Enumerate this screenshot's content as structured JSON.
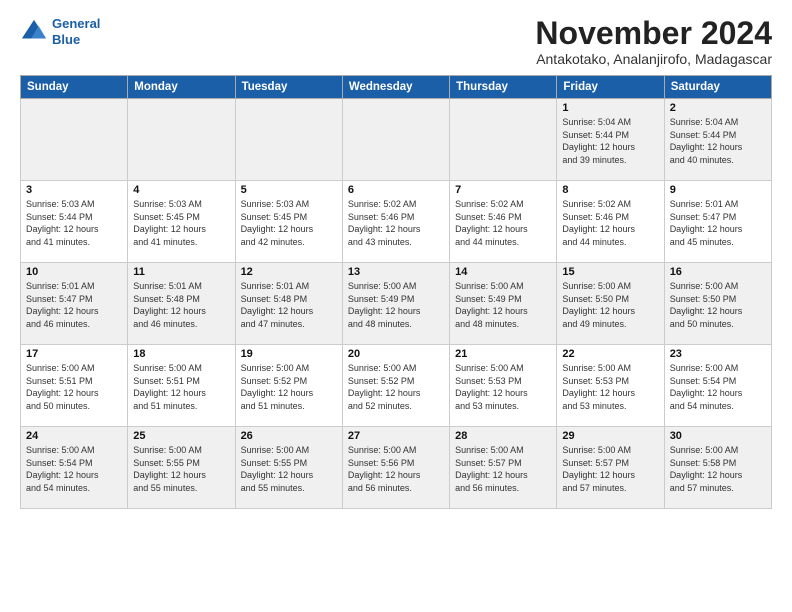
{
  "logo": {
    "line1": "General",
    "line2": "Blue"
  },
  "title": "November 2024",
  "subtitle": "Antakotako, Analanjirofo, Madagascar",
  "header_days": [
    "Sunday",
    "Monday",
    "Tuesday",
    "Wednesday",
    "Thursday",
    "Friday",
    "Saturday"
  ],
  "weeks": [
    [
      {
        "day": "",
        "info": ""
      },
      {
        "day": "",
        "info": ""
      },
      {
        "day": "",
        "info": ""
      },
      {
        "day": "",
        "info": ""
      },
      {
        "day": "",
        "info": ""
      },
      {
        "day": "1",
        "info": "Sunrise: 5:04 AM\nSunset: 5:44 PM\nDaylight: 12 hours\nand 39 minutes."
      },
      {
        "day": "2",
        "info": "Sunrise: 5:04 AM\nSunset: 5:44 PM\nDaylight: 12 hours\nand 40 minutes."
      }
    ],
    [
      {
        "day": "3",
        "info": "Sunrise: 5:03 AM\nSunset: 5:44 PM\nDaylight: 12 hours\nand 41 minutes."
      },
      {
        "day": "4",
        "info": "Sunrise: 5:03 AM\nSunset: 5:45 PM\nDaylight: 12 hours\nand 41 minutes."
      },
      {
        "day": "5",
        "info": "Sunrise: 5:03 AM\nSunset: 5:45 PM\nDaylight: 12 hours\nand 42 minutes."
      },
      {
        "day": "6",
        "info": "Sunrise: 5:02 AM\nSunset: 5:46 PM\nDaylight: 12 hours\nand 43 minutes."
      },
      {
        "day": "7",
        "info": "Sunrise: 5:02 AM\nSunset: 5:46 PM\nDaylight: 12 hours\nand 44 minutes."
      },
      {
        "day": "8",
        "info": "Sunrise: 5:02 AM\nSunset: 5:46 PM\nDaylight: 12 hours\nand 44 minutes."
      },
      {
        "day": "9",
        "info": "Sunrise: 5:01 AM\nSunset: 5:47 PM\nDaylight: 12 hours\nand 45 minutes."
      }
    ],
    [
      {
        "day": "10",
        "info": "Sunrise: 5:01 AM\nSunset: 5:47 PM\nDaylight: 12 hours\nand 46 minutes."
      },
      {
        "day": "11",
        "info": "Sunrise: 5:01 AM\nSunset: 5:48 PM\nDaylight: 12 hours\nand 46 minutes."
      },
      {
        "day": "12",
        "info": "Sunrise: 5:01 AM\nSunset: 5:48 PM\nDaylight: 12 hours\nand 47 minutes."
      },
      {
        "day": "13",
        "info": "Sunrise: 5:00 AM\nSunset: 5:49 PM\nDaylight: 12 hours\nand 48 minutes."
      },
      {
        "day": "14",
        "info": "Sunrise: 5:00 AM\nSunset: 5:49 PM\nDaylight: 12 hours\nand 48 minutes."
      },
      {
        "day": "15",
        "info": "Sunrise: 5:00 AM\nSunset: 5:50 PM\nDaylight: 12 hours\nand 49 minutes."
      },
      {
        "day": "16",
        "info": "Sunrise: 5:00 AM\nSunset: 5:50 PM\nDaylight: 12 hours\nand 50 minutes."
      }
    ],
    [
      {
        "day": "17",
        "info": "Sunrise: 5:00 AM\nSunset: 5:51 PM\nDaylight: 12 hours\nand 50 minutes."
      },
      {
        "day": "18",
        "info": "Sunrise: 5:00 AM\nSunset: 5:51 PM\nDaylight: 12 hours\nand 51 minutes."
      },
      {
        "day": "19",
        "info": "Sunrise: 5:00 AM\nSunset: 5:52 PM\nDaylight: 12 hours\nand 51 minutes."
      },
      {
        "day": "20",
        "info": "Sunrise: 5:00 AM\nSunset: 5:52 PM\nDaylight: 12 hours\nand 52 minutes."
      },
      {
        "day": "21",
        "info": "Sunrise: 5:00 AM\nSunset: 5:53 PM\nDaylight: 12 hours\nand 53 minutes."
      },
      {
        "day": "22",
        "info": "Sunrise: 5:00 AM\nSunset: 5:53 PM\nDaylight: 12 hours\nand 53 minutes."
      },
      {
        "day": "23",
        "info": "Sunrise: 5:00 AM\nSunset: 5:54 PM\nDaylight: 12 hours\nand 54 minutes."
      }
    ],
    [
      {
        "day": "24",
        "info": "Sunrise: 5:00 AM\nSunset: 5:54 PM\nDaylight: 12 hours\nand 54 minutes."
      },
      {
        "day": "25",
        "info": "Sunrise: 5:00 AM\nSunset: 5:55 PM\nDaylight: 12 hours\nand 55 minutes."
      },
      {
        "day": "26",
        "info": "Sunrise: 5:00 AM\nSunset: 5:55 PM\nDaylight: 12 hours\nand 55 minutes."
      },
      {
        "day": "27",
        "info": "Sunrise: 5:00 AM\nSunset: 5:56 PM\nDaylight: 12 hours\nand 56 minutes."
      },
      {
        "day": "28",
        "info": "Sunrise: 5:00 AM\nSunset: 5:57 PM\nDaylight: 12 hours\nand 56 minutes."
      },
      {
        "day": "29",
        "info": "Sunrise: 5:00 AM\nSunset: 5:57 PM\nDaylight: 12 hours\nand 57 minutes."
      },
      {
        "day": "30",
        "info": "Sunrise: 5:00 AM\nSunset: 5:58 PM\nDaylight: 12 hours\nand 57 minutes."
      }
    ]
  ]
}
